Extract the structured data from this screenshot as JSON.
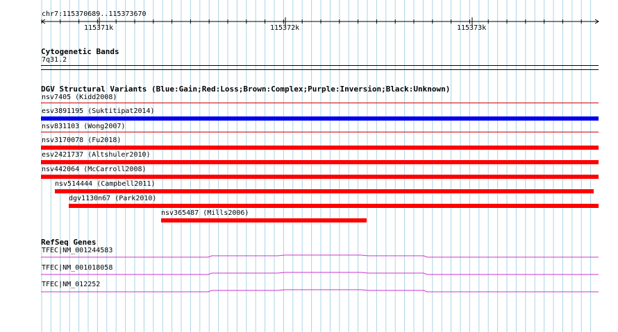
{
  "ruler": {
    "range_label": "chr7:115370689..115373670",
    "ticks": [
      "115371k",
      "115372k",
      "115373k"
    ]
  },
  "cytoband": {
    "title": "Cytogenetic Bands",
    "band": "7q31.2"
  },
  "dgv": {
    "title": "DGV Structural Variants (Blue:Gain;Red:Loss;Brown:Complex;Purple:Inversion;Black:Unknown)",
    "colors": {
      "gain": "#0000ee",
      "loss": "#ff0000",
      "line": "#cc0000"
    },
    "variants": [
      {
        "name": "nsv7405 (Kidd2008)",
        "type": "loss-line"
      },
      {
        "name": "esv3891195 (Suktitipat2014)",
        "type": "gain"
      },
      {
        "name": "nsv831103 (Wong2007)",
        "type": "loss-line"
      },
      {
        "name": "nsv3170078 (Fu2018)",
        "type": "loss"
      },
      {
        "name": "esv2421737 (Altshuler2010)",
        "type": "loss"
      },
      {
        "name": "nsv442064 (McCarroll2008)",
        "type": "loss"
      },
      {
        "name": "nsv514444 (Campbell2011)",
        "type": "loss"
      },
      {
        "name": "dgv1130n67 (Park2010)",
        "type": "loss"
      },
      {
        "name": "nsv365487 (Mills2006)",
        "type": "loss"
      }
    ]
  },
  "refseq": {
    "title": "RefSeq Genes",
    "color": "#cc33cc",
    "genes": [
      {
        "name": "TFEC|NM_001244583"
      },
      {
        "name": "TFEC|NM_001018058"
      },
      {
        "name": "TFEC|NM_012252"
      }
    ]
  },
  "grid_color": "#aad4e6"
}
